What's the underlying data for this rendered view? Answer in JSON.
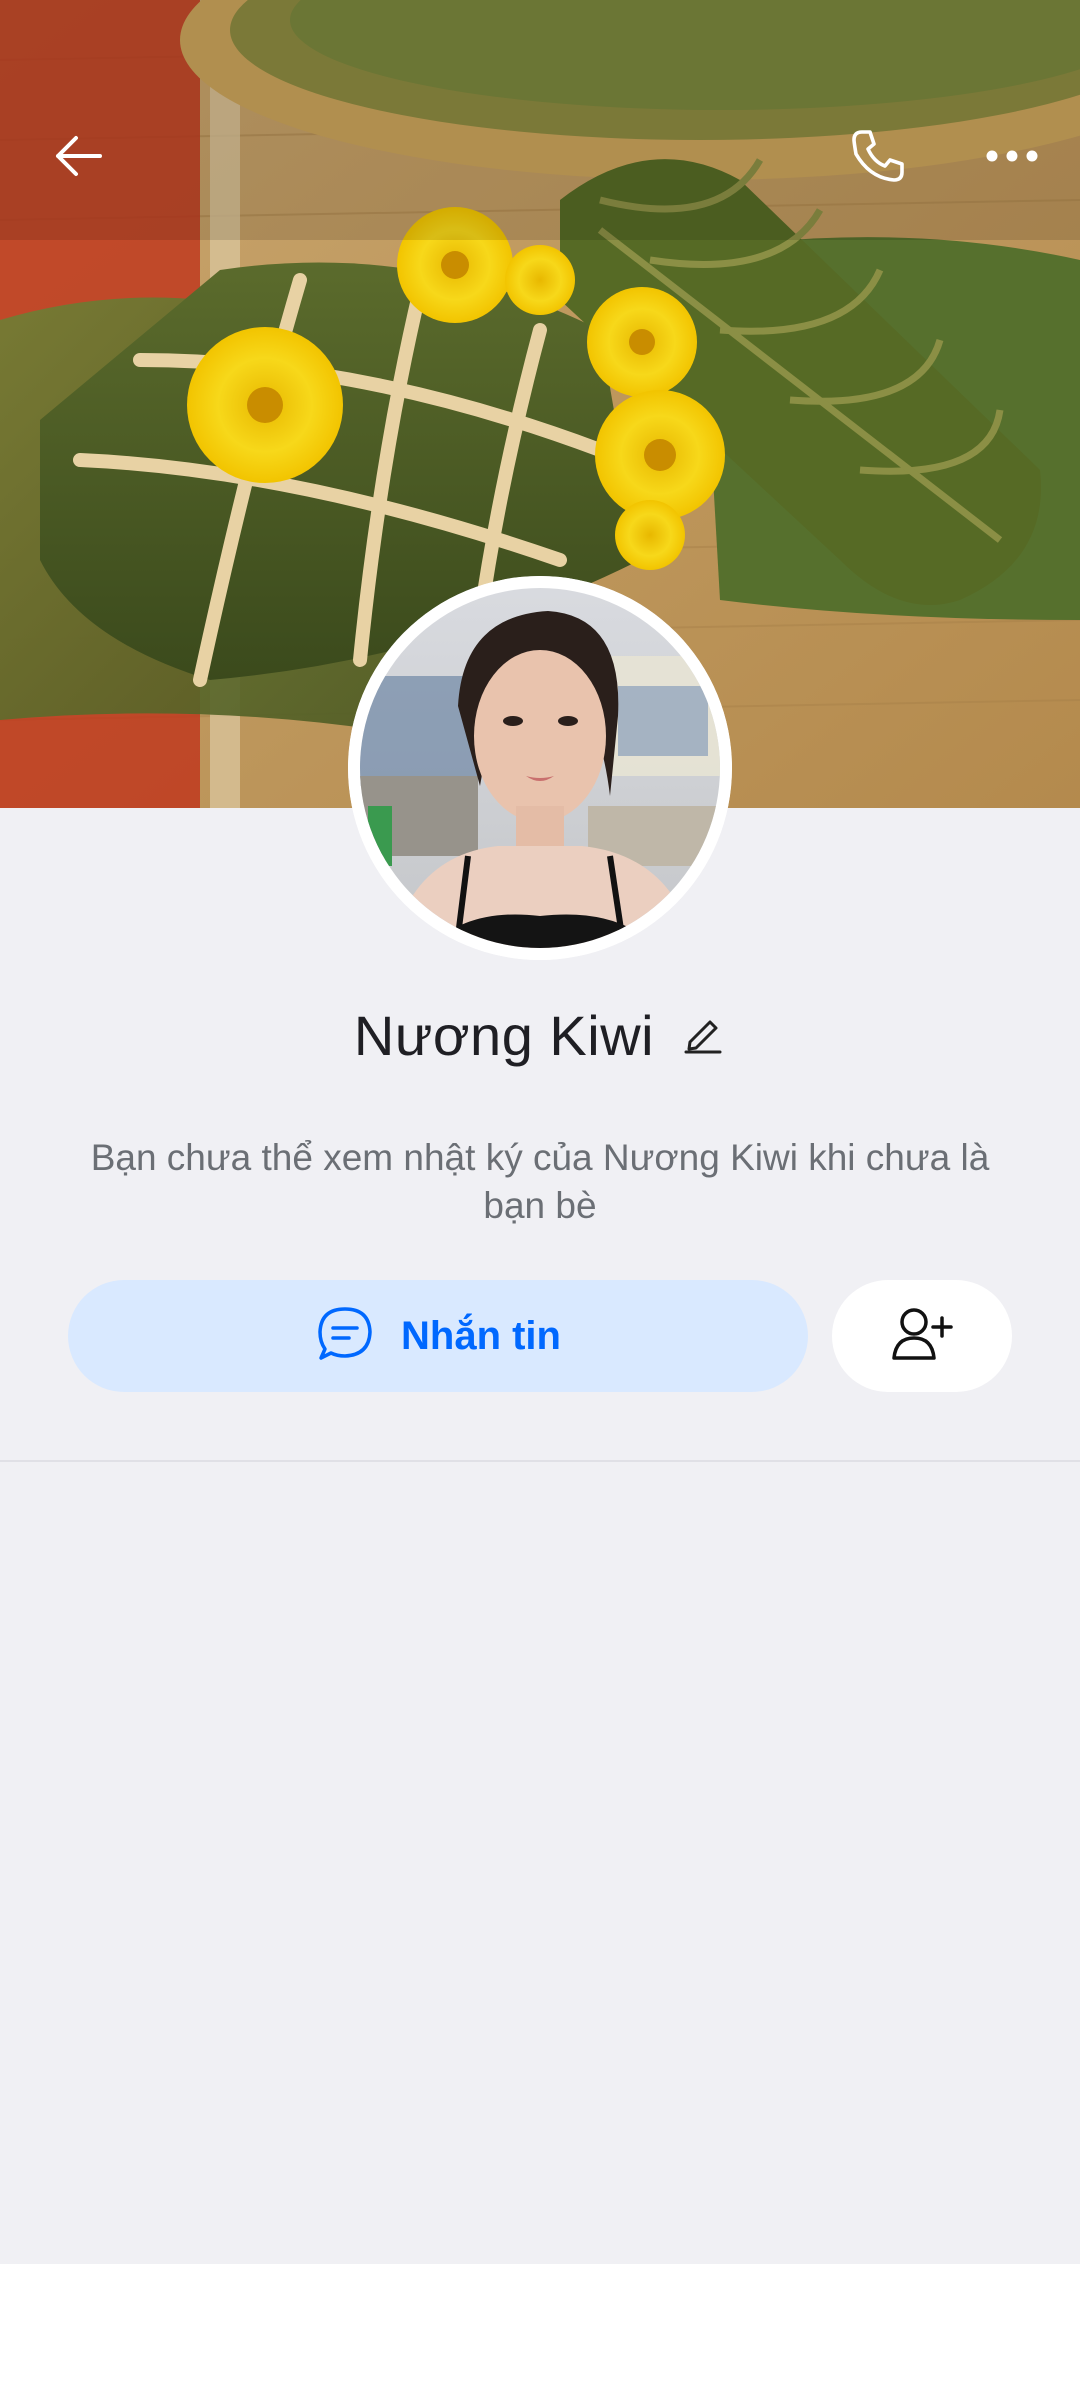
{
  "profile": {
    "name": "Nương Kiwi",
    "diary_notice": "Bạn chưa thể xem nhật ký của Nương Kiwi khi chưa là bạn bè"
  },
  "actions": {
    "message_label": "Nhắn tin"
  },
  "icons": {
    "back": "arrow-left-icon",
    "call": "phone-icon",
    "more": "more-dots-icon",
    "edit": "pencil-icon",
    "message": "chat-bubble-icon",
    "add_friend": "add-user-icon"
  },
  "colors": {
    "accent": "#0068ff",
    "message_button_bg": "#d9e9ff",
    "page_bg": "#f0f0f4",
    "name_text": "#1f1f24",
    "secondary_text": "#6b6f75"
  }
}
